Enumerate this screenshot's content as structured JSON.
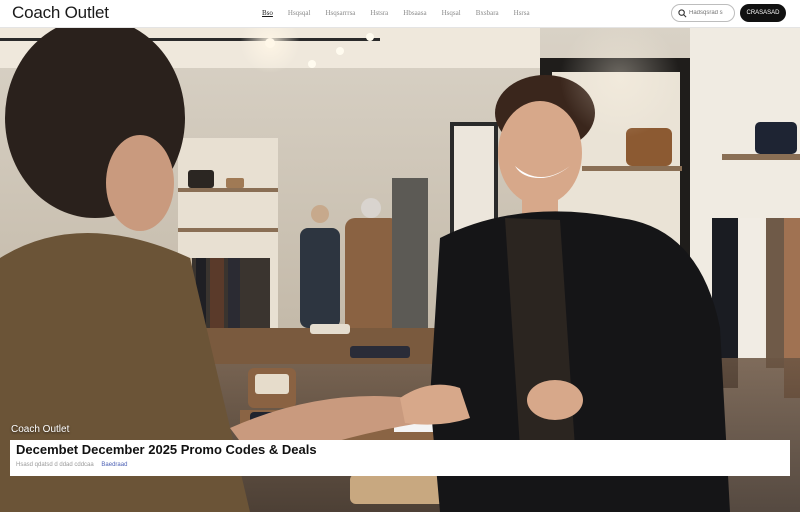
{
  "header": {
    "logo": "Coach Outlet",
    "nav": [
      "Bso",
      "Hsqsqal",
      "Hsqsarrrsa",
      "Hstsra",
      "Hbsaasa",
      "Hsqsal",
      "Bxsbara",
      "Hsrsa"
    ],
    "active_nav_index": 0,
    "search_placeholder": "Hadsqsrad s",
    "cta_label": "CRASASAD"
  },
  "hero": {
    "brand": "Coach Outlet",
    "title": "Decembet December 2025 Promo Codes & Deals",
    "meta_text": "Hsasd qdatsd d ddad cddcaa",
    "meta_tag": "Baedraad"
  },
  "colors": {
    "header_bg": "#ffffff",
    "cta_bg": "#111111",
    "tag_color": "#4d62b5"
  }
}
